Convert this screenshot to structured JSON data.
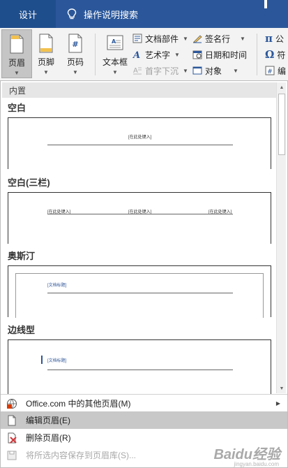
{
  "topbar": {
    "tab_design": "设计",
    "tell_me": "操作说明搜索"
  },
  "ribbon": {
    "header_label": "页眉",
    "footer_label": "页脚",
    "page_number_label": "页码",
    "textbox_label": "文本框",
    "quick_parts": "文档部件",
    "wordart": "艺术字",
    "drop_cap": "首字下沉",
    "signature_line": "签名行",
    "date_time": "日期和时间",
    "object": "对象",
    "equation": "公",
    "symbol": "符",
    "edit_cut": "编"
  },
  "gallery": {
    "section_label": "内置",
    "items": [
      {
        "title": "空白",
        "placeholders": [
          "[在此处键入]"
        ]
      },
      {
        "title": "空白(三栏)",
        "placeholders": [
          "[在此处键入]",
          "[在此处键入]",
          "[在此处键入]"
        ]
      },
      {
        "title": "奥斯汀",
        "placeholders": [
          "[文档标题]"
        ]
      },
      {
        "title": "边线型",
        "placeholders": [
          "[文档标题]"
        ]
      }
    ]
  },
  "menu": {
    "more_headers": "Office.com 中的其他页眉(M)",
    "edit_header": "编辑页眉(E)",
    "remove_header": "删除页眉(R)",
    "save_selection": "将所选内容保存到页眉库(S)..."
  },
  "watermark": {
    "brand": "Baidu经验",
    "url": "jingyan.baidu.com"
  }
}
